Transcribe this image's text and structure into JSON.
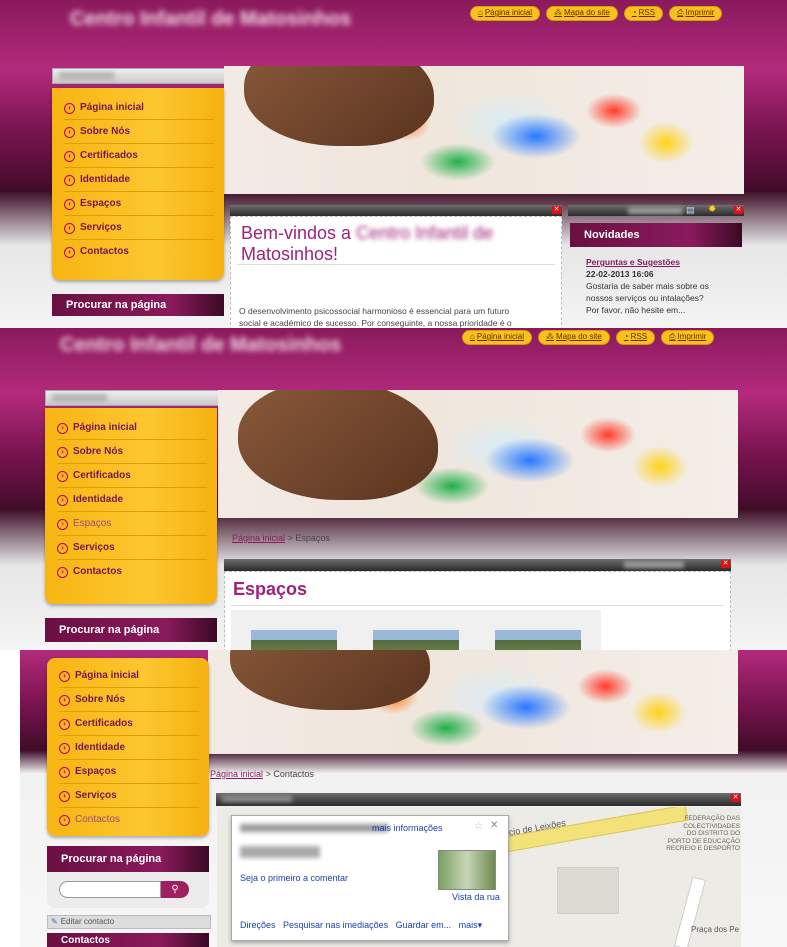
{
  "top_links": [
    {
      "label": "Página inicial",
      "icon": "home-icon",
      "glyph": "⌂"
    },
    {
      "label": "Mapa do site",
      "icon": "sitemap-icon",
      "glyph": "⁂"
    },
    {
      "label": "RSS",
      "icon": "rss-icon",
      "glyph": "◔"
    },
    {
      "label": "Imprimir",
      "icon": "print-icon",
      "glyph": "⎙"
    }
  ],
  "menu_items": [
    "Página inicial",
    "Sobre Nós",
    "Certificados",
    "Identidade",
    "Espaços",
    "Serviços",
    "Contactos"
  ],
  "search_heading": "Procurar na página",
  "panel1": {
    "welcome_title": "Bem-vindos a",
    "welcome_title_end": "Matosinhos!",
    "intro_text_1": "O desenvolvimento psicossocial harmonioso é essencial para um futuro",
    "intro_text_2": "social e académico de sucesso. Por conseguinte, a nossa prioridade é o",
    "news_heading": "Novidades",
    "news_link": "Perguntas e Sugestões",
    "news_date": "22-02-2013 16:06",
    "news_text_1": "Gostaria de saber mais sobre os",
    "news_text_2": "nossos serviços ou intalações?",
    "news_text_3": "Por favor, não hesite em..."
  },
  "panel2": {
    "breadcrumb_home": "Página inicial",
    "breadcrumb_sep": ">",
    "breadcrumb_current": "Espaços",
    "page_title": "Espaços"
  },
  "panel3": {
    "breadcrumb_home": "Página inicial",
    "breadcrumb_sep": ">",
    "breadcrumb_current": "Contactos",
    "map_more_info": "mais informações",
    "map_comment": "Seja o primeiro a comentar",
    "map_street_view": "Vista da rua",
    "map_directions": "Direções",
    "map_nearby": "Pesquisar nas imediações",
    "map_save": "Guardar em...",
    "map_more": "mais",
    "map_road": "mércio de Leixões",
    "map_place_1": "FEDERAÇÃO DAS",
    "map_place_2": "COLECTIVIDADES",
    "map_place_3": "DO DISTRITO DO",
    "map_place_4": "PORTO DE EDUCAÇÃO",
    "map_place_5": "RECREIO E DESPORTO",
    "map_square": "Praça dos Pe",
    "edit_contact": "Editar contacto",
    "contacts_heading": "Contactos"
  },
  "colors": {
    "brand": "#8a1a5c",
    "menu": "#f7b512",
    "accent": "#b5005f"
  }
}
